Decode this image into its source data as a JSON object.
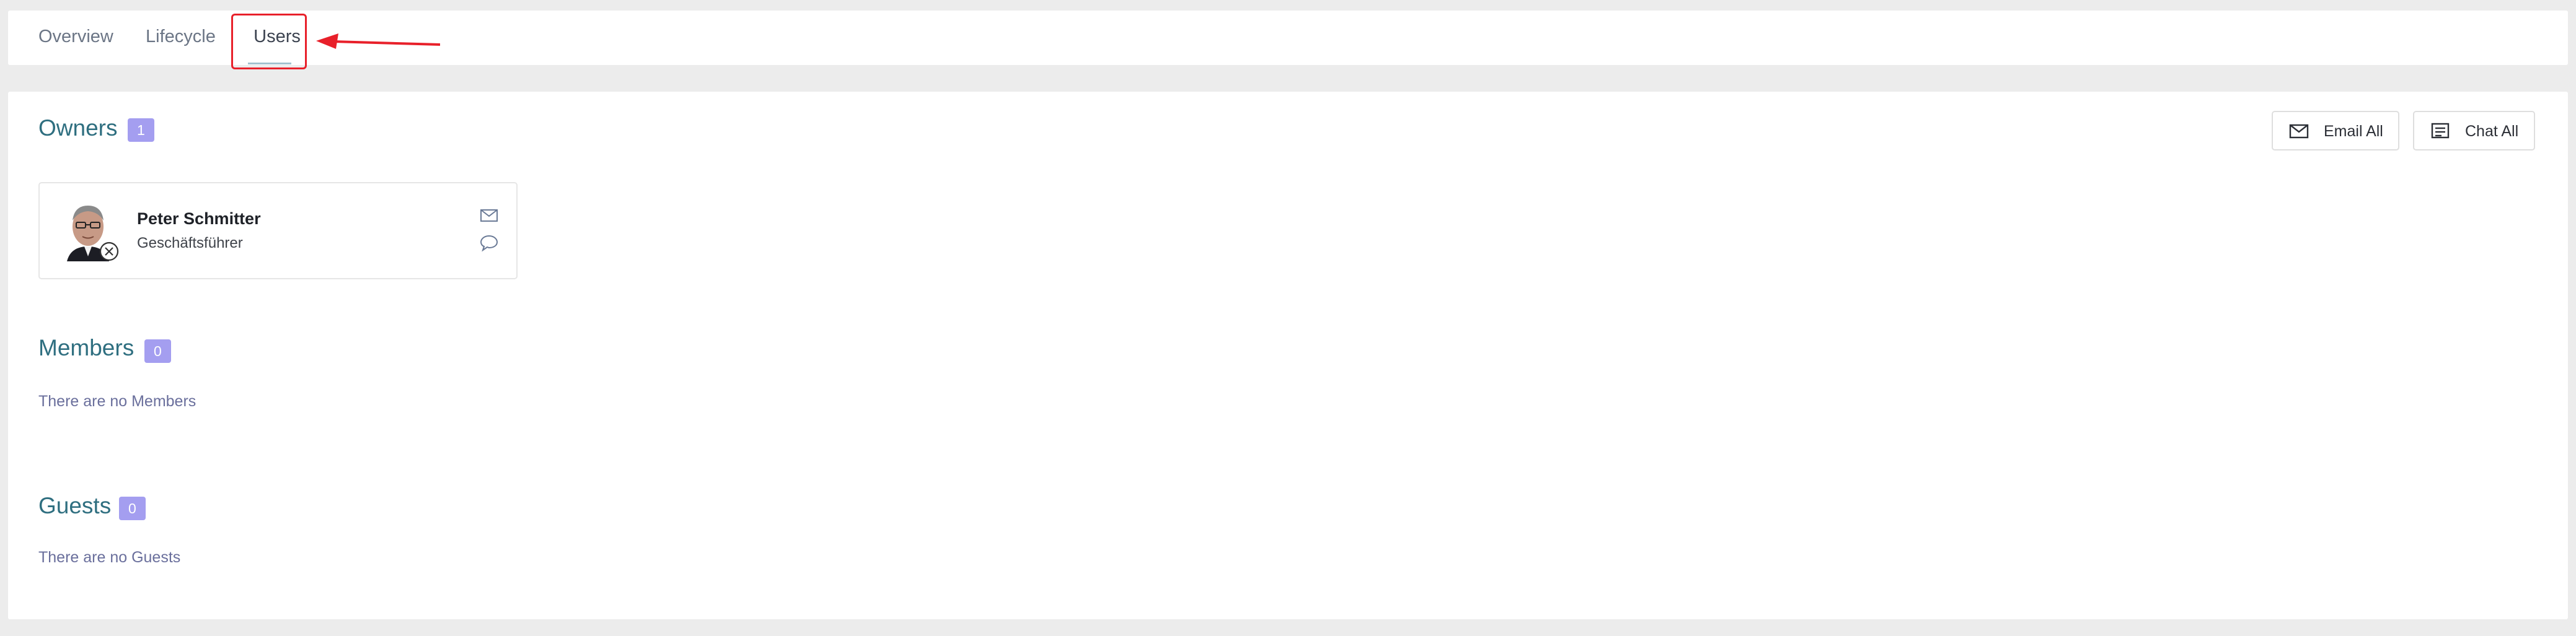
{
  "tabs": [
    {
      "label": "Overview",
      "active": false
    },
    {
      "label": "Lifecycle",
      "active": false
    },
    {
      "label": "Users",
      "active": true
    }
  ],
  "colors": {
    "accent_title": "#2f6f80",
    "badge_bg": "#a49ef0",
    "highlight": "#e8202a",
    "page_bg": "#ececec"
  },
  "actions": {
    "email_all": "Email All",
    "chat_all": "Chat All"
  },
  "sections": {
    "owners": {
      "title": "Owners",
      "count": "1"
    },
    "members": {
      "title": "Members",
      "count": "0",
      "empty": "There are no Members"
    },
    "guests": {
      "title": "Guests",
      "count": "0",
      "empty": "There are no Guests"
    }
  },
  "owner_card": {
    "name": "Peter Schmitter",
    "role": "Geschäftsführer",
    "icons": [
      "avatar-photo",
      "remove-x-icon",
      "mail-icon",
      "chat-bubble-icon"
    ]
  }
}
